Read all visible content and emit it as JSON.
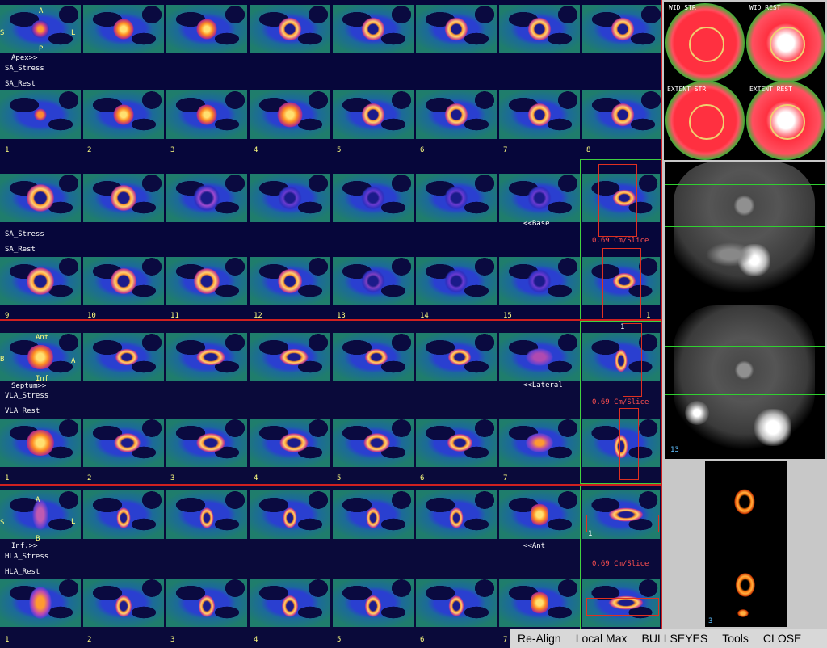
{
  "sa": {
    "orient_a": "A",
    "orient_s": "S",
    "orient_l": "L",
    "orient_p": "P",
    "apex": "Apex>>",
    "base": "<<Base",
    "stress": "SA_Stress",
    "rest": "SA_Rest",
    "stress2": "SA_Stress",
    "rest2": "SA_Rest",
    "slice_info": "0.69 Cm/Slice",
    "nums_row1": [
      "1",
      "2",
      "3",
      "4",
      "5",
      "6",
      "7",
      "8"
    ],
    "nums_row2": [
      "9",
      "10",
      "11",
      "12",
      "13",
      "14",
      "15",
      "1"
    ]
  },
  "vla": {
    "ant": "Ant",
    "b": "B",
    "a": "A",
    "inf": "Inf",
    "septum": "Septum>>",
    "lateral": "<<Lateral",
    "stress": "VLA_Stress",
    "rest": "VLA_Rest",
    "slice_info": "0.69 Cm/Slice",
    "nums": [
      "1",
      "2",
      "3",
      "4",
      "5",
      "6",
      "7"
    ],
    "side_num": "1"
  },
  "hla": {
    "a": "A",
    "s": "S",
    "l": "L",
    "b": "B",
    "inf": "Inf.>>",
    "ant": "<<Ant",
    "stress": "HLA_Stress",
    "rest": "HLA_Rest",
    "slice_info": "0.69 Cm/Slice",
    "nums": [
      "1",
      "2",
      "3",
      "4",
      "5",
      "6",
      "7"
    ],
    "side_num": "1"
  },
  "bullseyes": {
    "tl": "WID STR",
    "tr": "WID REST",
    "bl": "EXTENT STR",
    "br": "EXTENT REST"
  },
  "projection": {
    "frame_num": "13"
  },
  "mini": {
    "frame_num": "3"
  },
  "toolbar": {
    "realign": "Re-Align",
    "localmax": "Local Max",
    "bullseyes": "BULLSEYES",
    "tools": "Tools",
    "close": "CLOSE"
  }
}
